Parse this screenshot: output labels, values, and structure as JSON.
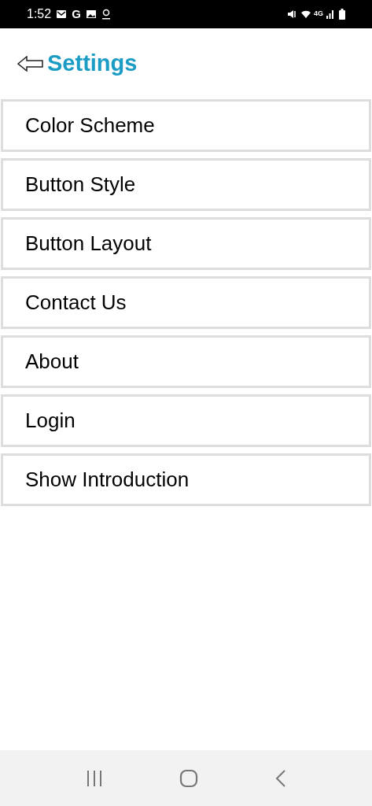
{
  "status_bar": {
    "time": "1:52",
    "app_letter": "G",
    "network": "4G"
  },
  "header": {
    "title": "Settings"
  },
  "menu_items": [
    {
      "label": "Color Scheme"
    },
    {
      "label": "Button Style"
    },
    {
      "label": "Button Layout"
    },
    {
      "label": "Contact Us"
    },
    {
      "label": "About"
    },
    {
      "label": "Login"
    },
    {
      "label": "Show Introduction"
    }
  ]
}
